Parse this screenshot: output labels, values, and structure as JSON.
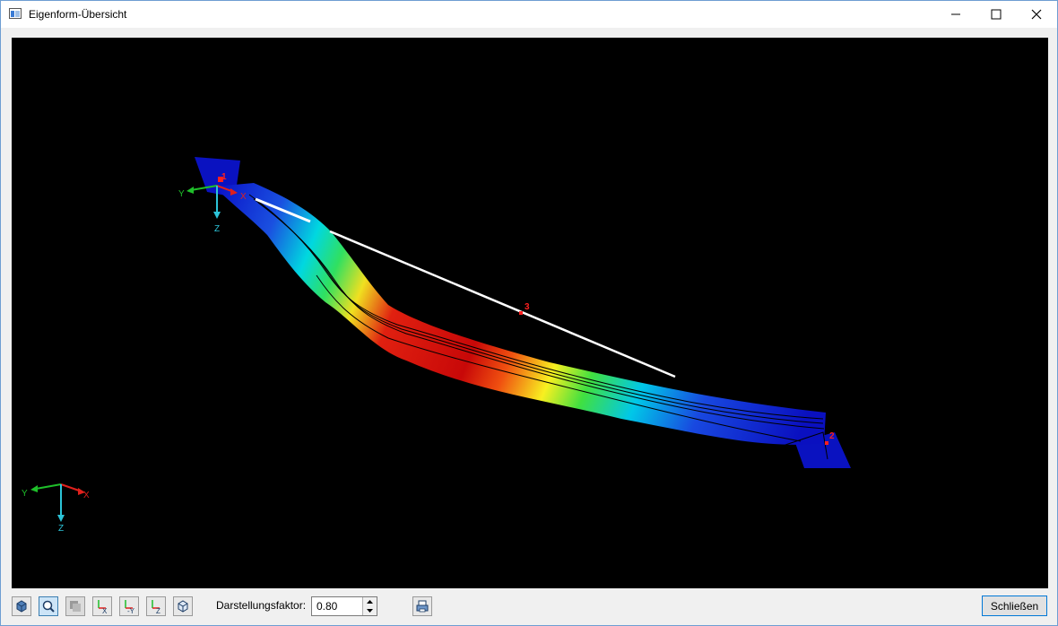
{
  "window": {
    "title": "Eigenform-Übersicht",
    "icon": "app-window-icon",
    "controls": [
      "minimize-icon",
      "maximize-icon",
      "close-icon"
    ]
  },
  "viewport": {
    "background": "#000000",
    "node_labels": [
      "1",
      "2",
      "3"
    ],
    "local_axes": {
      "x": "X",
      "y": "Y",
      "z": "Z"
    },
    "global_axes": {
      "x": "X",
      "y": "Y",
      "z": "Z"
    },
    "colors": {
      "x_axis": "#e0201c",
      "y_axis": "#1fbf2a",
      "z_axis": "#2cc4d8",
      "node_label": "#ff2020",
      "cable": "#ffffff"
    }
  },
  "toolbar": {
    "buttons": [
      {
        "name": "view-3d-button",
        "icon": "iso-view-icon"
      },
      {
        "name": "zoom-button",
        "icon": "magnifier-icon"
      },
      {
        "name": "render-mode-button",
        "icon": "render-icon"
      },
      {
        "name": "view-x-button",
        "icon": "view-x-icon",
        "label": "X"
      },
      {
        "name": "view-minus-y-button",
        "icon": "view-minus-y-icon",
        "label": "-Y"
      },
      {
        "name": "view-z-button",
        "icon": "view-z-icon",
        "label": "Z"
      },
      {
        "name": "view-iso-button",
        "icon": "box-icon"
      }
    ],
    "factor_label": "Darstellungsfaktor:",
    "factor_value": "0.80",
    "print_icon": "print-icon",
    "close_label": "Schließen"
  }
}
